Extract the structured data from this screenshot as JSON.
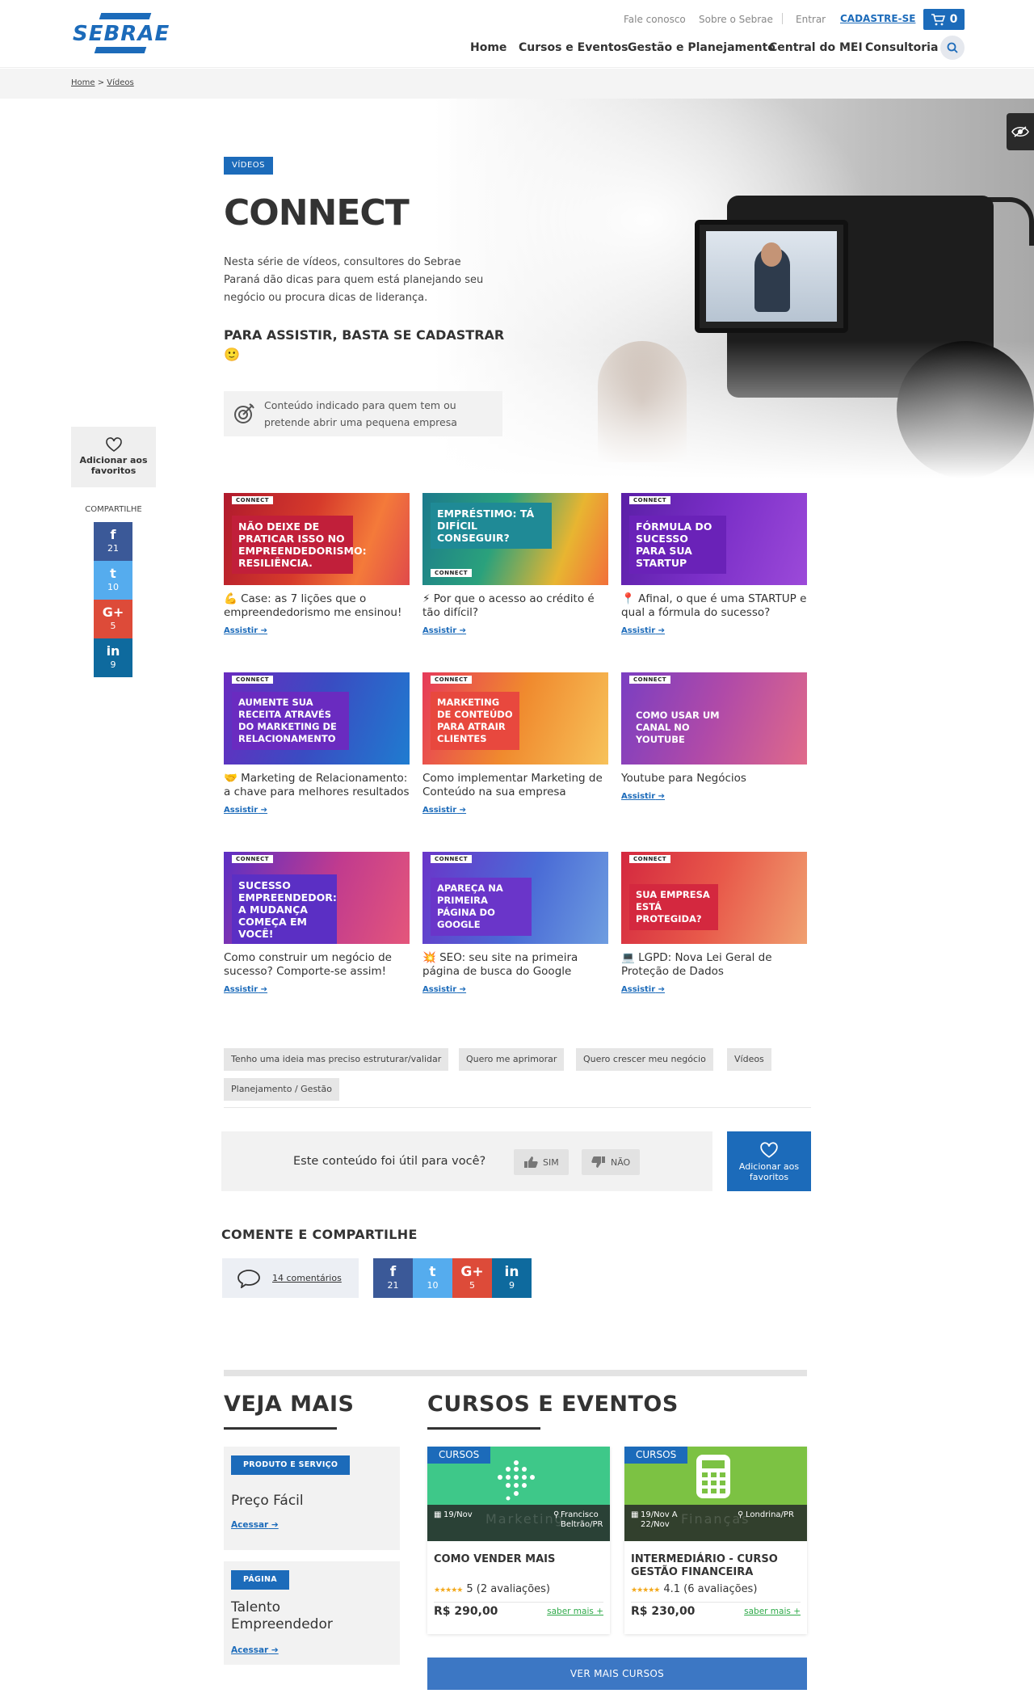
{
  "header": {
    "logo": "SEBRAE",
    "util": {
      "contact": "Fale conosco",
      "about": "Sobre o Sebrae",
      "login": "Entrar",
      "signup": "CADASTRE-SE",
      "cart_count": "0"
    },
    "nav": [
      "Home",
      "Cursos e Eventos",
      "Gestão e Planejamento",
      "Central do MEI",
      "Consultoria"
    ]
  },
  "breadcrumb": {
    "home": "Home",
    "sep": ">",
    "current": "Vídeos"
  },
  "hero": {
    "tag": "VÍDEOS",
    "title": "CONNECT",
    "description": "Nesta série de vídeos, consultores do Sebrae Paraná dão dicas para quem está planejando seu negócio ou procura dicas de liderança.",
    "cta": "PARA ASSISTIR, BASTA SE CADASTRAR",
    "cta_emoji": "🙂",
    "audience": "Conteúdo indicado para quem tem ou pretende abrir uma pequena empresa"
  },
  "sidebar": {
    "favorite": "Adicionar aos favoritos",
    "share_label": "COMPARTILHE",
    "shares": [
      {
        "glyph": "f",
        "count": "21"
      },
      {
        "glyph": "t",
        "count": "10"
      },
      {
        "glyph": "G+",
        "count": "5"
      },
      {
        "glyph": "in",
        "count": "9"
      }
    ]
  },
  "cards": [
    {
      "brand": "CONNECT",
      "thumb_title": "NÃO DEIXE DE PRATICAR ISSO NO EMPREENDEDORISMO: RESILIÊNCIA.",
      "title": "💪 Case: as 7 lições que o empreendedorismo me ensinou!",
      "link": "Assistir"
    },
    {
      "brand": "CONNECT",
      "thumb_title": "EMPRÉSTIMO: TÁ DIFÍCIL CONSEGUIR?",
      "title": "⚡ Por que o acesso ao crédito é tão difícil?",
      "link": "Assistir"
    },
    {
      "brand": "CONNECT",
      "thumb_title": "FÓRMULA DO SUCESSO PARA SUA STARTUP",
      "title": "📍 Afinal, o que é uma STARTUP e qual a fórmula do sucesso?",
      "link": "Assistir"
    },
    {
      "brand": "CONNECT",
      "thumb_title": "AUMENTE SUA RECEITA ATRAVÉS DO MARKETING DE RELACIONAMENTO",
      "title": "🤝 Marketing de Relacionamento: a chave para melhores resultados",
      "link": "Assistir"
    },
    {
      "brand": "CONNECT",
      "thumb_title": "MARKETING DE CONTEÚDO PARA ATRAIR CLIENTES",
      "title": "Como implementar Marketing de Conteúdo na sua empresa",
      "link": "Assistir"
    },
    {
      "brand": "CONNECT",
      "thumb_title": "COMO USAR UM CANAL NO YOUTUBE",
      "title": "Youtube para Negócios",
      "link": "Assistir"
    },
    {
      "brand": "CONNECT",
      "thumb_title": "SUCESSO EMPREENDEDOR: A MUDANÇA COMEÇA EM VOCÊ!",
      "title": "Como construir um negócio de sucesso? Comporte-se assim!",
      "link": "Assistir"
    },
    {
      "brand": "CONNECT",
      "thumb_title": "APAREÇA NA PRIMEIRA PÁGINA DO GOOGLE",
      "title": "💥 SEO: seu site na primeira página de busca do Google",
      "link": "Assistir"
    },
    {
      "brand": "CONNECT",
      "thumb_title": "SUA EMPRESA ESTÁ PROTEGIDA?",
      "title": "💻 LGPD: Nova Lei Geral de Proteção de Dados",
      "link": "Assistir"
    }
  ],
  "tags": [
    "Tenho uma ideia mas preciso estruturar/validar",
    "Quero me aprimorar",
    "Quero crescer meu negócio",
    "Vídeos",
    "Planejamento / Gestão"
  ],
  "feedback": {
    "question": "Este conteúdo foi útil para você?",
    "yes": "SIM",
    "no": "NÃO",
    "favorite": "Adicionar aos favoritos"
  },
  "comments": {
    "heading": "COMENTE E COMPARTILHE",
    "count_label": "14 comentários"
  },
  "see_more": {
    "heading": "VEJA MAIS",
    "items": [
      {
        "type": "PRODUTO E SERVIÇO",
        "name": "Preço Fácil",
        "link": "Acessar"
      },
      {
        "type": "PÁGINA",
        "name": "Talento Empreendedor",
        "link": "Acessar"
      }
    ]
  },
  "courses": {
    "heading": "CURSOS E EVENTOS",
    "items": [
      {
        "category": "CURSOS",
        "watermark": "Marketing",
        "date": "19/Nov",
        "location": "Francisco Beltrão/PR",
        "name": "COMO VENDER MAIS",
        "rating": "5",
        "reviews": "(2 avaliações)",
        "stars": "★★★★★",
        "price": "R$ 290,00",
        "more": "saber mais +",
        "color": "#3ec889"
      },
      {
        "category": "CURSOS",
        "watermark": "Finanças",
        "date": "19/Nov A 22/Nov",
        "location": "Londrina/PR",
        "name": "INTERMEDIÁRIO - CURSO GESTÃO FINANCEIRA",
        "rating": "4.1",
        "reviews": "(6 avaliações)",
        "stars": "★★★★★",
        "price": "R$ 230,00",
        "more": "saber mais +",
        "color": "#7cc243"
      }
    ],
    "more_button": "VER MAIS CURSOS"
  },
  "colors": {
    "brand_blue": "#1c6bba",
    "facebook": "#3b5998",
    "twitter": "#55acee",
    "google": "#dd4b39",
    "linkedin": "#0e6a9e"
  }
}
